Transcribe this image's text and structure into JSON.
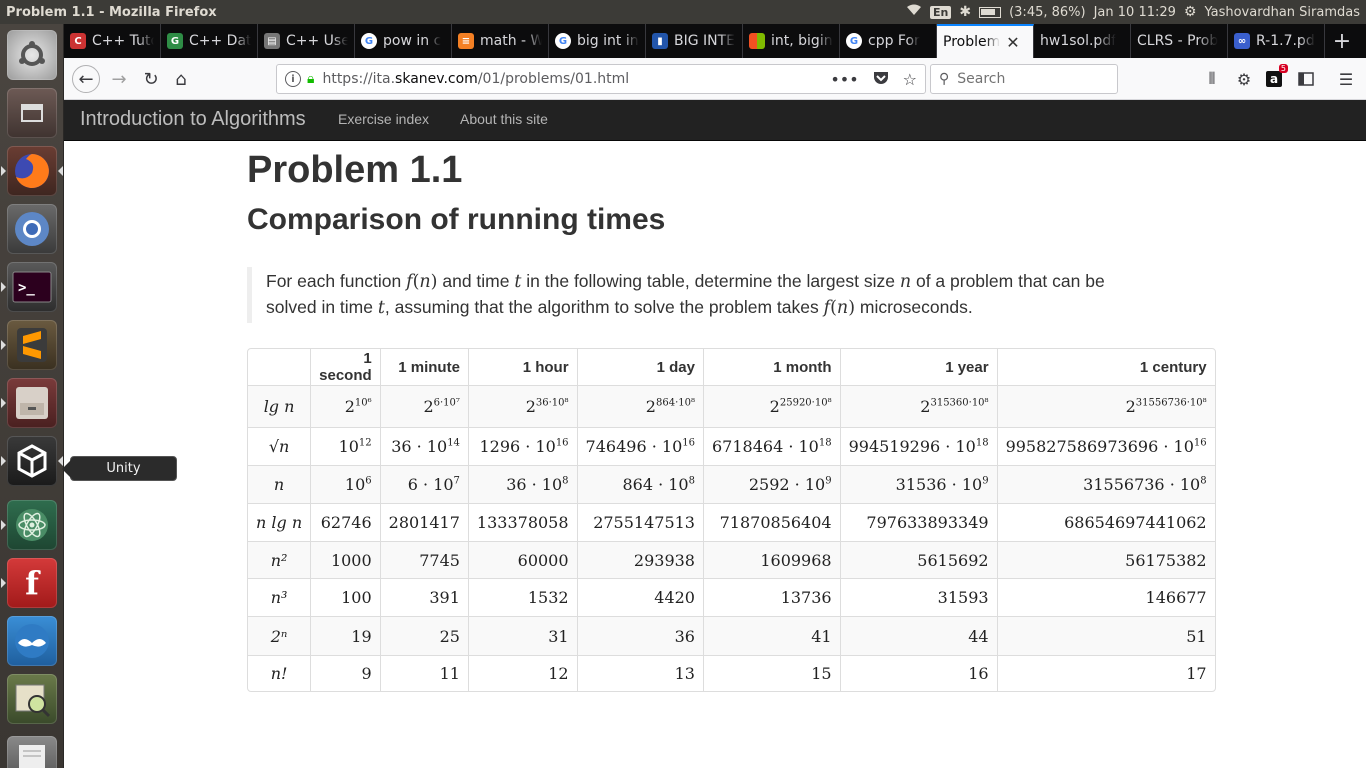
{
  "os": {
    "window_title": "Problem 1.1 - Mozilla Firefox",
    "keyboard_layout": "En",
    "battery": "(3:45, 86%)",
    "clock": "Jan 10 11:29",
    "user": "Yashovardhan Siramdas"
  },
  "launcher": {
    "tooltip": "Unity"
  },
  "tabs": [
    {
      "label": "C++ Tuto",
      "icon": "cplusplus-icon",
      "color": "#cc3333"
    },
    {
      "label": "C++ Data",
      "icon": "geeksforgeeks-icon",
      "color": "#2f8d46"
    },
    {
      "label": "C++ User",
      "icon": "document-icon",
      "color": "#777777"
    },
    {
      "label": "pow in c",
      "icon": "google-icon",
      "color": "#4285f4"
    },
    {
      "label": "math - W",
      "icon": "stackoverflow-icon",
      "color": "#f48024"
    },
    {
      "label": "big int in",
      "icon": "google-icon",
      "color": "#4285f4"
    },
    {
      "label": "BIG INTE",
      "icon": "chart-icon",
      "color": "#2255aa"
    },
    {
      "label": "int, bigin",
      "icon": "microsoft-icon",
      "color": "#f25022"
    },
    {
      "label": "cpp For",
      "icon": "google-icon",
      "color": "#4285f4"
    },
    {
      "label": "Problem",
      "icon": "",
      "color": "",
      "active": true
    },
    {
      "label": "hw1sol.pdf",
      "icon": "",
      "color": ""
    },
    {
      "label": "CLRS - Prob",
      "icon": "",
      "color": ""
    },
    {
      "label": "R-1.7.pd",
      "icon": "visualstudio-icon",
      "color": "#3a5fcd"
    }
  ],
  "navbar": {
    "url_host_prefix": "https://ita.",
    "url_host_bold": "skanev.com",
    "url_path": "/01/problems/01.html",
    "search_placeholder": "Search",
    "notification_count": "5"
  },
  "site": {
    "brand": "Introduction to Algorithms",
    "links": [
      "Exercise index",
      "About this site"
    ]
  },
  "page": {
    "title": "Problem 1.1",
    "subtitle": "Comparison of running times",
    "statement_parts": [
      "For each function ",
      " and time ",
      " in the following table, determine the largest size ",
      " of a problem that can be solved in time ",
      ", assuming that the algorithm to solve the problem takes ",
      " microseconds."
    ],
    "math": {
      "f": "f",
      "n": "n",
      "t": "t"
    }
  },
  "table": {
    "headers": [
      "",
      "1 second",
      "1 minute",
      "1 hour",
      "1 day",
      "1 month",
      "1 year",
      "1 century"
    ],
    "rows": [
      {
        "label": "lg n",
        "cells": [
          {
            "base": "2",
            "exp": "10⁶"
          },
          {
            "base": "2",
            "exp": "6·10⁷"
          },
          {
            "base": "2",
            "exp": "36·10⁸"
          },
          {
            "base": "2",
            "exp": "864·10⁸"
          },
          {
            "base": "2",
            "exp": "25920·10⁸"
          },
          {
            "base": "2",
            "exp": "315360·10⁸"
          },
          {
            "base": "2",
            "exp": "31556736·10⁸"
          }
        ]
      },
      {
        "label": "√n",
        "cells": [
          {
            "base": "10",
            "exp": "12"
          },
          {
            "base": "36 · 10",
            "exp": "14"
          },
          {
            "base": "1296 · 10",
            "exp": "16"
          },
          {
            "base": "746496 · 10",
            "exp": "16"
          },
          {
            "base": "6718464 · 10",
            "exp": "18"
          },
          {
            "base": "994519296 · 10",
            "exp": "18"
          },
          {
            "base": "995827586973696 · 10",
            "exp": "16"
          }
        ]
      },
      {
        "label": "n",
        "cells": [
          {
            "base": "10",
            "exp": "6"
          },
          {
            "base": "6 · 10",
            "exp": "7"
          },
          {
            "base": "36 · 10",
            "exp": "8"
          },
          {
            "base": "864 · 10",
            "exp": "8"
          },
          {
            "base": "2592 · 10",
            "exp": "9"
          },
          {
            "base": "31536 · 10",
            "exp": "9"
          },
          {
            "base": "31556736 · 10",
            "exp": "8"
          }
        ]
      },
      {
        "label": "n lg n",
        "cells": [
          {
            "base": "62746"
          },
          {
            "base": "2801417"
          },
          {
            "base": "133378058"
          },
          {
            "base": "2755147513"
          },
          {
            "base": "71870856404"
          },
          {
            "base": "797633893349"
          },
          {
            "base": "68654697441062"
          }
        ]
      },
      {
        "label": "n²",
        "cells": [
          {
            "base": "1000"
          },
          {
            "base": "7745"
          },
          {
            "base": "60000"
          },
          {
            "base": "293938"
          },
          {
            "base": "1609968"
          },
          {
            "base": "5615692"
          },
          {
            "base": "56175382"
          }
        ]
      },
      {
        "label": "n³",
        "cells": [
          {
            "base": "100"
          },
          {
            "base": "391"
          },
          {
            "base": "1532"
          },
          {
            "base": "4420"
          },
          {
            "base": "13736"
          },
          {
            "base": "31593"
          },
          {
            "base": "146677"
          }
        ]
      },
      {
        "label": "2ⁿ",
        "cells": [
          {
            "base": "19"
          },
          {
            "base": "25"
          },
          {
            "base": "31"
          },
          {
            "base": "36"
          },
          {
            "base": "41"
          },
          {
            "base": "44"
          },
          {
            "base": "51"
          }
        ]
      },
      {
        "label": "n!",
        "cells": [
          {
            "base": "9"
          },
          {
            "base": "11"
          },
          {
            "base": "12"
          },
          {
            "base": "13"
          },
          {
            "base": "15"
          },
          {
            "base": "16"
          },
          {
            "base": "17"
          }
        ]
      }
    ]
  }
}
